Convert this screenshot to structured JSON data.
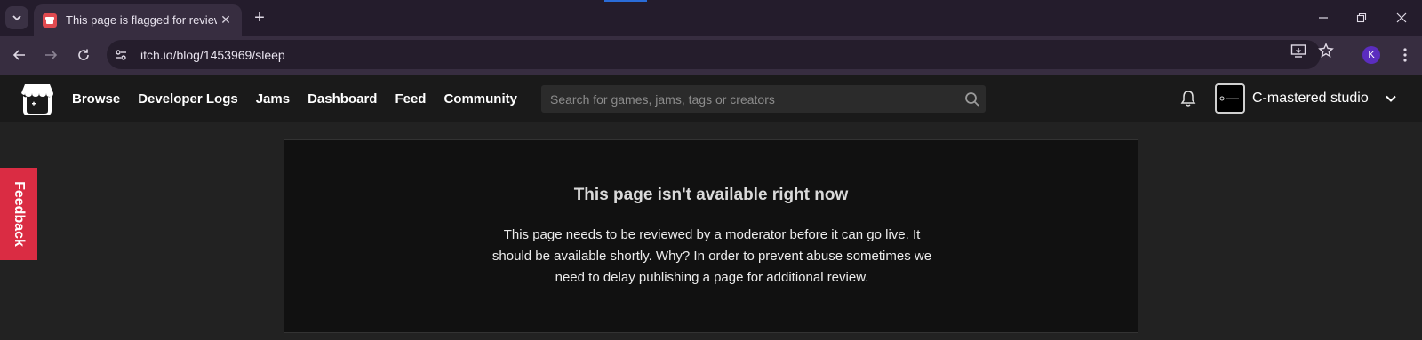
{
  "browser": {
    "tab": {
      "title": "This page is flagged for review",
      "close": "✕"
    },
    "new_tab": "+",
    "url": "itch.io/blog/1453969/sleep",
    "profile_initial": "K"
  },
  "itch": {
    "nav": [
      "Browse",
      "Developer Logs",
      "Jams",
      "Dashboard",
      "Feed",
      "Community"
    ],
    "search": {
      "placeholder": "Search for games, jams, tags or creators"
    },
    "user": {
      "name": "C-mastered studio"
    },
    "feedback": "Feedback"
  },
  "notice": {
    "title": "This page isn't available right now",
    "body": "This page needs to be reviewed by a moderator before it can go live. It should be available shortly. Why? In order to prevent abuse sometimes we need to delay publishing a page for additional review."
  },
  "colors": {
    "accent_red": "#da2c43",
    "profile": "#5b2dbf"
  },
  "icons": [
    "tab-search-icon",
    "itch-favicon-icon",
    "close-icon",
    "new-tab-icon",
    "minimize-icon",
    "restore-icon",
    "window-close-icon",
    "back-icon",
    "forward-icon",
    "reload-icon",
    "site-info-icon",
    "install-icon",
    "star-icon",
    "menu-icon",
    "itch-logo-icon",
    "search-icon",
    "bell-icon",
    "chevron-down-icon"
  ]
}
